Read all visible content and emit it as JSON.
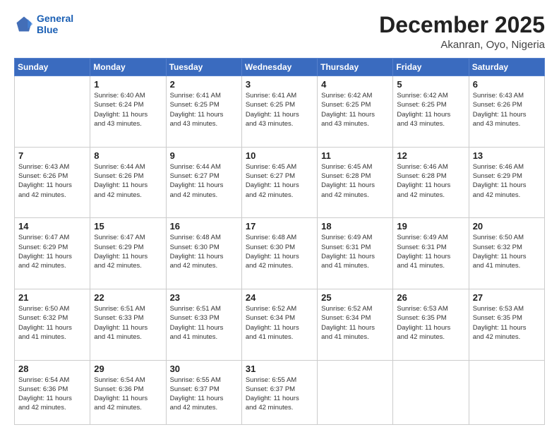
{
  "header": {
    "logo_line1": "General",
    "logo_line2": "Blue",
    "month": "December 2025",
    "location": "Akanran, Oyo, Nigeria"
  },
  "weekdays": [
    "Sunday",
    "Monday",
    "Tuesday",
    "Wednesday",
    "Thursday",
    "Friday",
    "Saturday"
  ],
  "weeks": [
    [
      {
        "day": "",
        "sunrise": "",
        "sunset": "",
        "daylight": ""
      },
      {
        "day": "1",
        "sunrise": "Sunrise: 6:40 AM",
        "sunset": "Sunset: 6:24 PM",
        "daylight": "Daylight: 11 hours and 43 minutes."
      },
      {
        "day": "2",
        "sunrise": "Sunrise: 6:41 AM",
        "sunset": "Sunset: 6:25 PM",
        "daylight": "Daylight: 11 hours and 43 minutes."
      },
      {
        "day": "3",
        "sunrise": "Sunrise: 6:41 AM",
        "sunset": "Sunset: 6:25 PM",
        "daylight": "Daylight: 11 hours and 43 minutes."
      },
      {
        "day": "4",
        "sunrise": "Sunrise: 6:42 AM",
        "sunset": "Sunset: 6:25 PM",
        "daylight": "Daylight: 11 hours and 43 minutes."
      },
      {
        "day": "5",
        "sunrise": "Sunrise: 6:42 AM",
        "sunset": "Sunset: 6:25 PM",
        "daylight": "Daylight: 11 hours and 43 minutes."
      },
      {
        "day": "6",
        "sunrise": "Sunrise: 6:43 AM",
        "sunset": "Sunset: 6:26 PM",
        "daylight": "Daylight: 11 hours and 43 minutes."
      }
    ],
    [
      {
        "day": "7",
        "sunrise": "Sunrise: 6:43 AM",
        "sunset": "Sunset: 6:26 PM",
        "daylight": "Daylight: 11 hours and 42 minutes."
      },
      {
        "day": "8",
        "sunrise": "Sunrise: 6:44 AM",
        "sunset": "Sunset: 6:26 PM",
        "daylight": "Daylight: 11 hours and 42 minutes."
      },
      {
        "day": "9",
        "sunrise": "Sunrise: 6:44 AM",
        "sunset": "Sunset: 6:27 PM",
        "daylight": "Daylight: 11 hours and 42 minutes."
      },
      {
        "day": "10",
        "sunrise": "Sunrise: 6:45 AM",
        "sunset": "Sunset: 6:27 PM",
        "daylight": "Daylight: 11 hours and 42 minutes."
      },
      {
        "day": "11",
        "sunrise": "Sunrise: 6:45 AM",
        "sunset": "Sunset: 6:28 PM",
        "daylight": "Daylight: 11 hours and 42 minutes."
      },
      {
        "day": "12",
        "sunrise": "Sunrise: 6:46 AM",
        "sunset": "Sunset: 6:28 PM",
        "daylight": "Daylight: 11 hours and 42 minutes."
      },
      {
        "day": "13",
        "sunrise": "Sunrise: 6:46 AM",
        "sunset": "Sunset: 6:29 PM",
        "daylight": "Daylight: 11 hours and 42 minutes."
      }
    ],
    [
      {
        "day": "14",
        "sunrise": "Sunrise: 6:47 AM",
        "sunset": "Sunset: 6:29 PM",
        "daylight": "Daylight: 11 hours and 42 minutes."
      },
      {
        "day": "15",
        "sunrise": "Sunrise: 6:47 AM",
        "sunset": "Sunset: 6:29 PM",
        "daylight": "Daylight: 11 hours and 42 minutes."
      },
      {
        "day": "16",
        "sunrise": "Sunrise: 6:48 AM",
        "sunset": "Sunset: 6:30 PM",
        "daylight": "Daylight: 11 hours and 42 minutes."
      },
      {
        "day": "17",
        "sunrise": "Sunrise: 6:48 AM",
        "sunset": "Sunset: 6:30 PM",
        "daylight": "Daylight: 11 hours and 42 minutes."
      },
      {
        "day": "18",
        "sunrise": "Sunrise: 6:49 AM",
        "sunset": "Sunset: 6:31 PM",
        "daylight": "Daylight: 11 hours and 41 minutes."
      },
      {
        "day": "19",
        "sunrise": "Sunrise: 6:49 AM",
        "sunset": "Sunset: 6:31 PM",
        "daylight": "Daylight: 11 hours and 41 minutes."
      },
      {
        "day": "20",
        "sunrise": "Sunrise: 6:50 AM",
        "sunset": "Sunset: 6:32 PM",
        "daylight": "Daylight: 11 hours and 41 minutes."
      }
    ],
    [
      {
        "day": "21",
        "sunrise": "Sunrise: 6:50 AM",
        "sunset": "Sunset: 6:32 PM",
        "daylight": "Daylight: 11 hours and 41 minutes."
      },
      {
        "day": "22",
        "sunrise": "Sunrise: 6:51 AM",
        "sunset": "Sunset: 6:33 PM",
        "daylight": "Daylight: 11 hours and 41 minutes."
      },
      {
        "day": "23",
        "sunrise": "Sunrise: 6:51 AM",
        "sunset": "Sunset: 6:33 PM",
        "daylight": "Daylight: 11 hours and 41 minutes."
      },
      {
        "day": "24",
        "sunrise": "Sunrise: 6:52 AM",
        "sunset": "Sunset: 6:34 PM",
        "daylight": "Daylight: 11 hours and 41 minutes."
      },
      {
        "day": "25",
        "sunrise": "Sunrise: 6:52 AM",
        "sunset": "Sunset: 6:34 PM",
        "daylight": "Daylight: 11 hours and 41 minutes."
      },
      {
        "day": "26",
        "sunrise": "Sunrise: 6:53 AM",
        "sunset": "Sunset: 6:35 PM",
        "daylight": "Daylight: 11 hours and 42 minutes."
      },
      {
        "day": "27",
        "sunrise": "Sunrise: 6:53 AM",
        "sunset": "Sunset: 6:35 PM",
        "daylight": "Daylight: 11 hours and 42 minutes."
      }
    ],
    [
      {
        "day": "28",
        "sunrise": "Sunrise: 6:54 AM",
        "sunset": "Sunset: 6:36 PM",
        "daylight": "Daylight: 11 hours and 42 minutes."
      },
      {
        "day": "29",
        "sunrise": "Sunrise: 6:54 AM",
        "sunset": "Sunset: 6:36 PM",
        "daylight": "Daylight: 11 hours and 42 minutes."
      },
      {
        "day": "30",
        "sunrise": "Sunrise: 6:55 AM",
        "sunset": "Sunset: 6:37 PM",
        "daylight": "Daylight: 11 hours and 42 minutes."
      },
      {
        "day": "31",
        "sunrise": "Sunrise: 6:55 AM",
        "sunset": "Sunset: 6:37 PM",
        "daylight": "Daylight: 11 hours and 42 minutes."
      },
      {
        "day": "",
        "sunrise": "",
        "sunset": "",
        "daylight": ""
      },
      {
        "day": "",
        "sunrise": "",
        "sunset": "",
        "daylight": ""
      },
      {
        "day": "",
        "sunrise": "",
        "sunset": "",
        "daylight": ""
      }
    ]
  ]
}
